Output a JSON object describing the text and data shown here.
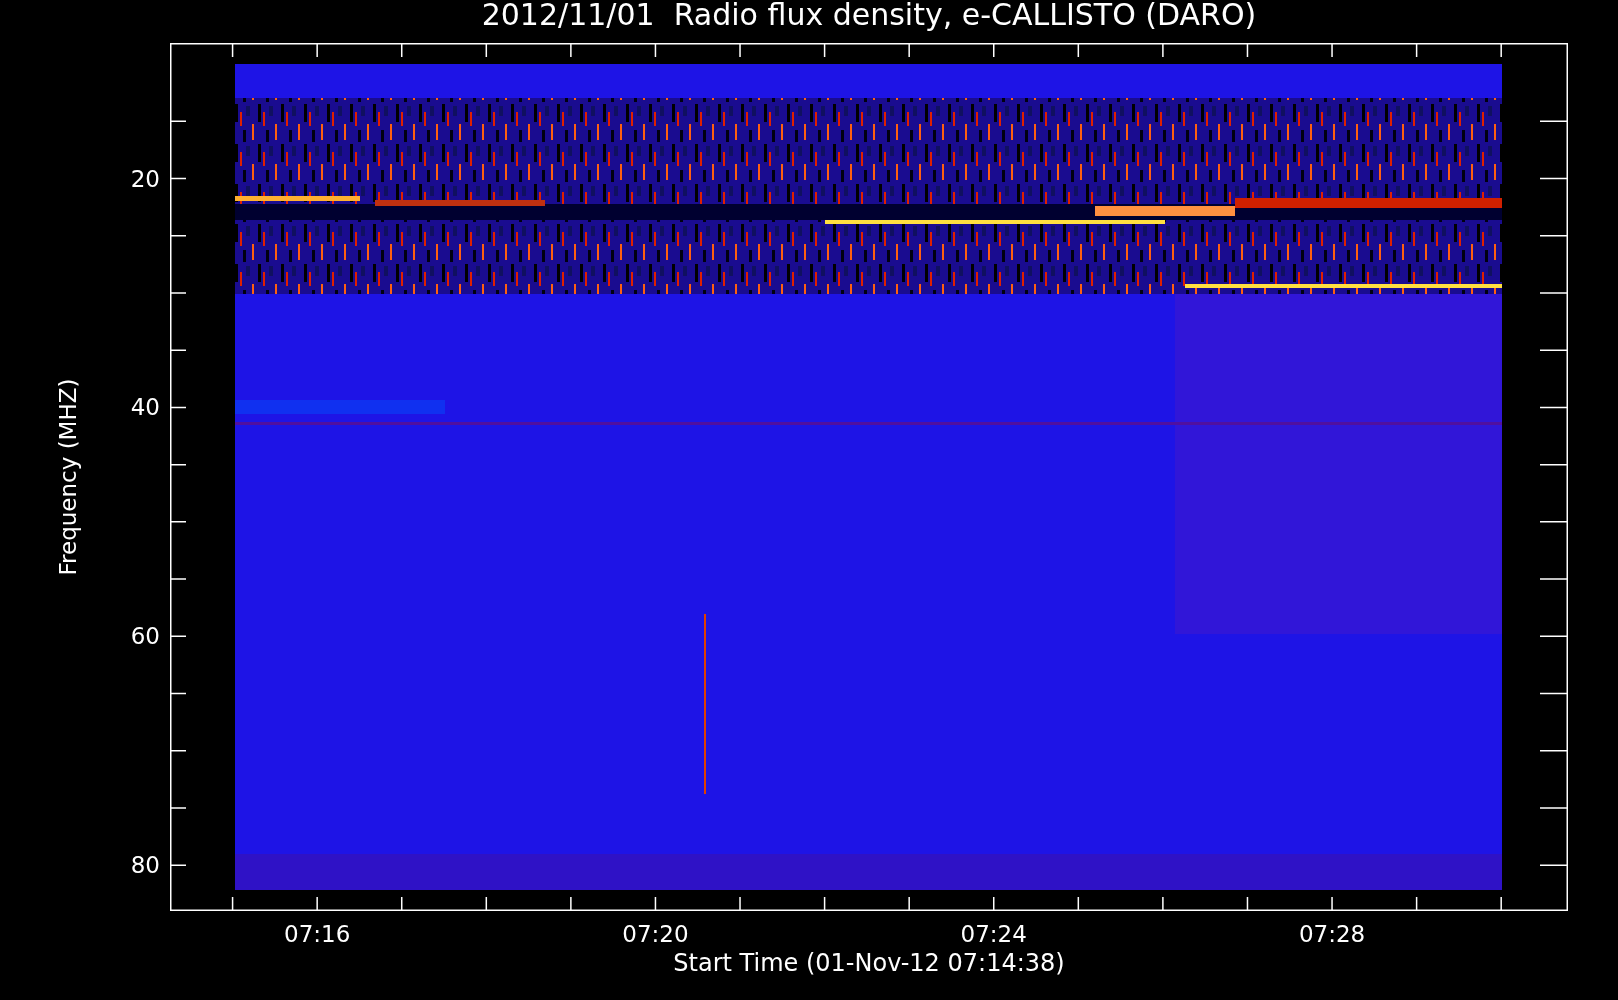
{
  "title": "2012/11/01  Radio flux density, e-CALLISTO (DARO)",
  "plot": {
    "ylabel": "Frequency (MHZ)",
    "xlabel": "Start Time (01-Nov-12 07:14:38)",
    "y_tick_labels": [
      "20",
      "40",
      "60",
      "80"
    ],
    "x_tick_labels": [
      "07:16",
      "07:20",
      "07:24",
      "07:28"
    ]
  }
}
